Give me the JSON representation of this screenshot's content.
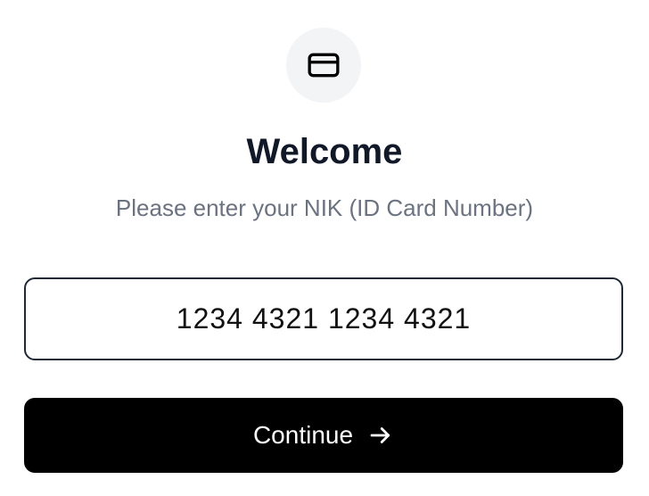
{
  "header": {
    "icon": "credit-card-icon",
    "title": "Welcome",
    "subtitle": "Please enter your NIK (ID Card Number)"
  },
  "form": {
    "nik_value": "1234 4321 1234 4321",
    "continue_label": "Continue",
    "continue_icon": "arrow-right-icon"
  },
  "colors": {
    "title": "#111827",
    "subtitle": "#6b7280",
    "input_border": "#1f2937",
    "button_bg": "#000000",
    "button_text": "#ffffff",
    "icon_circle_bg": "#f3f4f6"
  }
}
